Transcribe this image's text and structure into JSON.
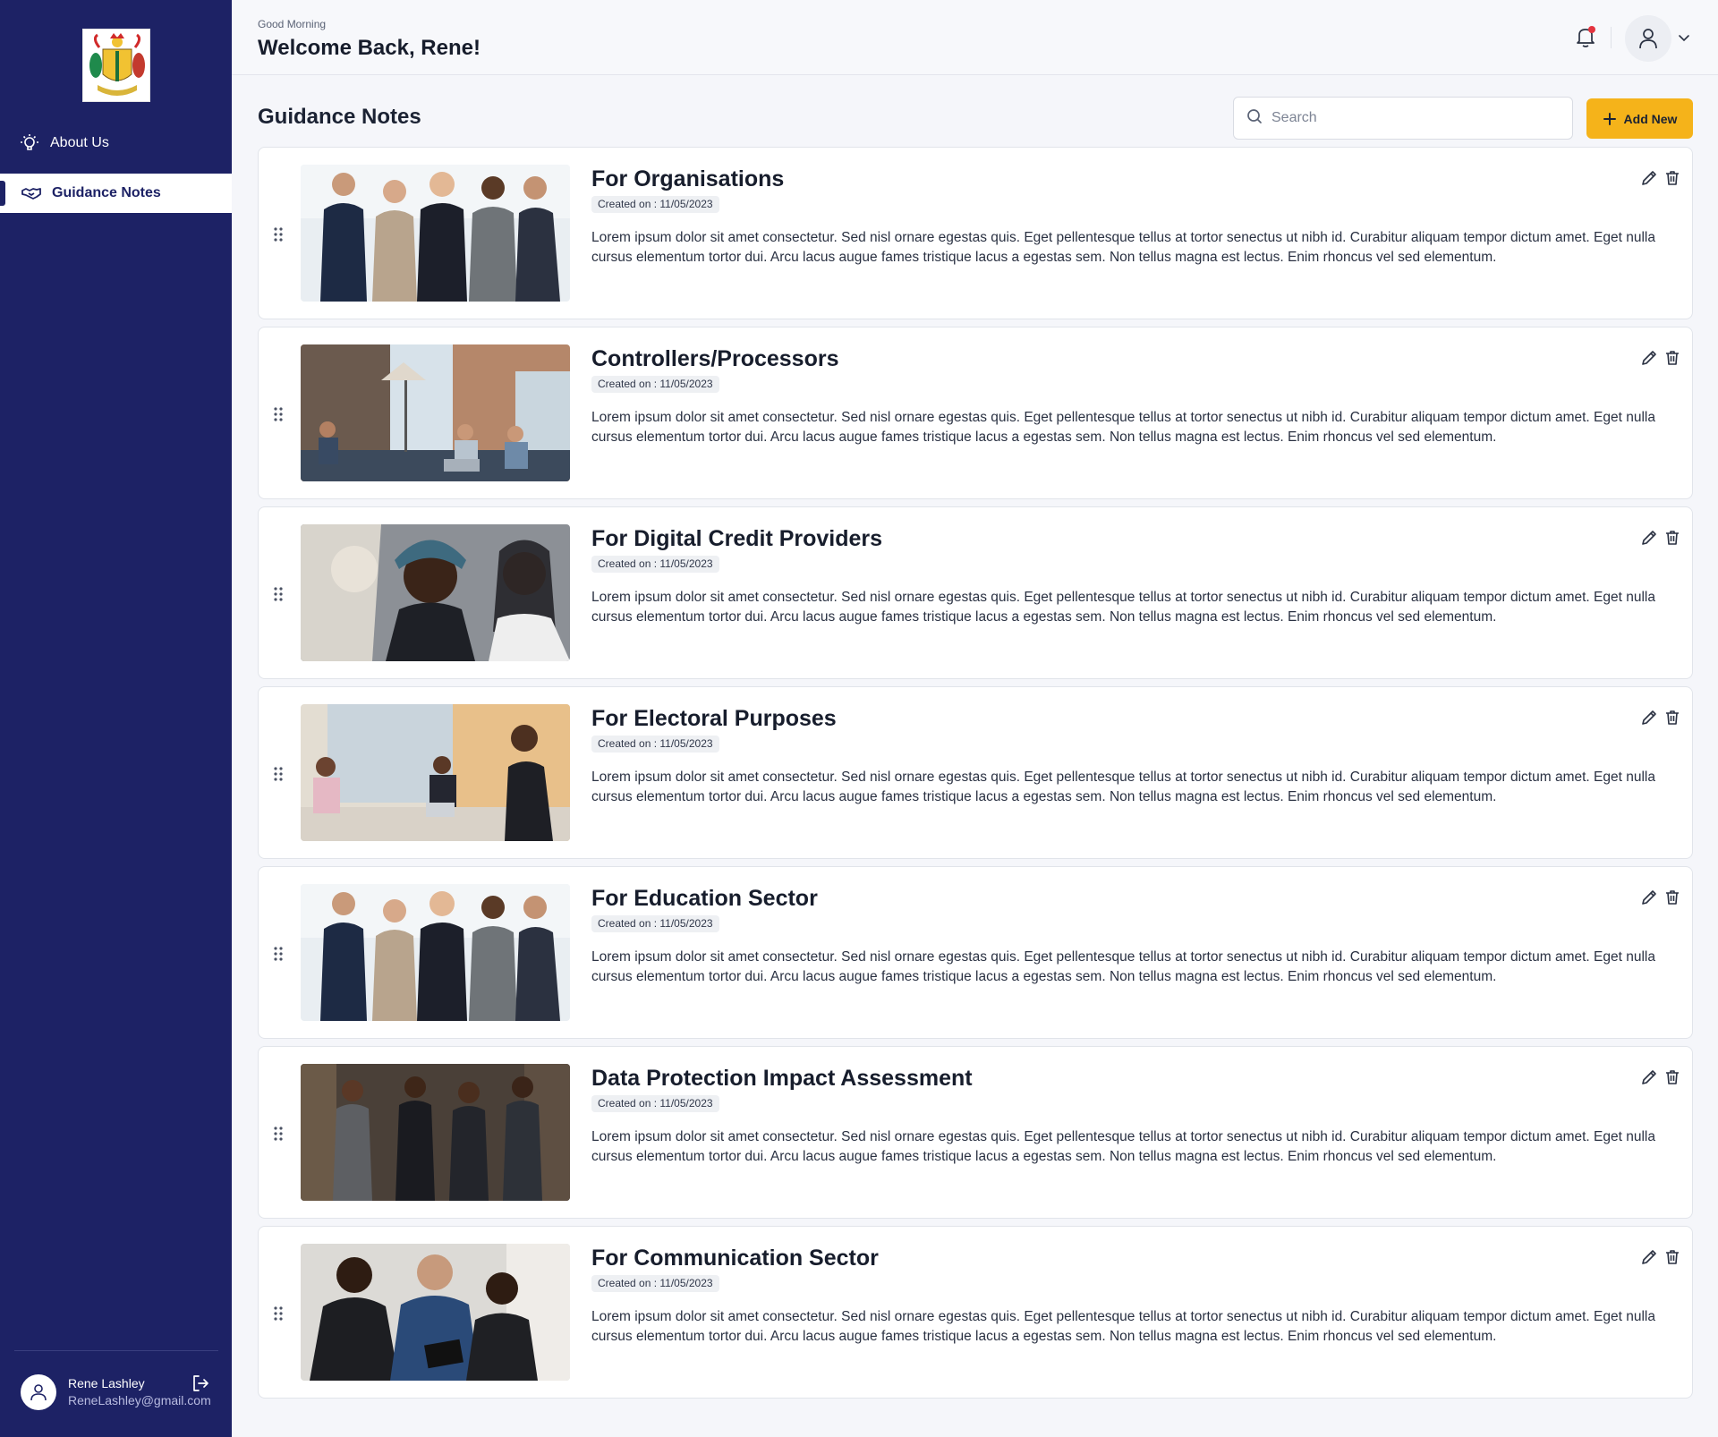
{
  "sidebar": {
    "items": [
      {
        "label": "About Us",
        "icon": "bulb-icon"
      },
      {
        "label": "Guidance Notes",
        "icon": "handshake-icon",
        "active": true
      }
    ],
    "user": {
      "name": "Rene Lashley",
      "email": "ReneLashley@gmail.com"
    }
  },
  "header": {
    "greeting": "Good Morning",
    "welcome": "Welcome Back, Rene!"
  },
  "main": {
    "title": "Guidance Notes",
    "search_placeholder": "Search",
    "add_label": "Add New",
    "cards": [
      {
        "title": "For Organisations",
        "created": "Created on : 11/05/2023",
        "description": "Lorem ipsum dolor sit amet consectetur. Sed nisl ornare egestas quis. Eget pellentesque tellus at tortor senectus ut nibh id. Curabitur aliquam tempor dictum amet. Eget nulla cursus elementum tortor dui. Arcu lacus augue fames tristique lacus a egestas sem. Non tellus magna est lectus. Enim rhoncus vel sed elementum."
      },
      {
        "title": "Controllers/Processors",
        "created": "Created on : 11/05/2023",
        "description": "Lorem ipsum dolor sit amet consectetur. Sed nisl ornare egestas quis. Eget pellentesque tellus at tortor senectus ut nibh id. Curabitur aliquam tempor dictum amet. Eget nulla cursus elementum tortor dui. Arcu lacus augue fames tristique lacus a egestas sem. Non tellus magna est lectus. Enim rhoncus vel sed elementum."
      },
      {
        "title": "For Digital Credit Providers",
        "created": "Created on : 11/05/2023",
        "description": "Lorem ipsum dolor sit amet consectetur. Sed nisl ornare egestas quis. Eget pellentesque tellus at tortor senectus ut nibh id. Curabitur aliquam tempor dictum amet. Eget nulla cursus elementum tortor dui. Arcu lacus augue fames tristique lacus a egestas sem. Non tellus magna est lectus. Enim rhoncus vel sed elementum."
      },
      {
        "title": "For Electoral Purposes",
        "created": "Created on : 11/05/2023",
        "description": "Lorem ipsum dolor sit amet consectetur. Sed nisl ornare egestas quis. Eget pellentesque tellus at tortor senectus ut nibh id. Curabitur aliquam tempor dictum amet. Eget nulla cursus elementum tortor dui. Arcu lacus augue fames tristique lacus a egestas sem. Non tellus magna est lectus. Enim rhoncus vel sed elementum."
      },
      {
        "title": "For Education Sector",
        "created": "Created on : 11/05/2023",
        "description": "Lorem ipsum dolor sit amet consectetur. Sed nisl ornare egestas quis. Eget pellentesque tellus at tortor senectus ut nibh id. Curabitur aliquam tempor dictum amet. Eget nulla cursus elementum tortor dui. Arcu lacus augue fames tristique lacus a egestas sem. Non tellus magna est lectus. Enim rhoncus vel sed elementum."
      },
      {
        "title": "Data Protection Impact Assessment",
        "created": "Created on : 11/05/2023",
        "description": "Lorem ipsum dolor sit amet consectetur. Sed nisl ornare egestas quis. Eget pellentesque tellus at tortor senectus ut nibh id. Curabitur aliquam tempor dictum amet. Eget nulla cursus elementum tortor dui. Arcu lacus augue fames tristique lacus a egestas sem. Non tellus magna est lectus. Enim rhoncus vel sed elementum."
      },
      {
        "title": "For Communication Sector",
        "created": "Created on : 11/05/2023",
        "description": "Lorem ipsum dolor sit amet consectetur. Sed nisl ornare egestas quis. Eget pellentesque tellus at tortor senectus ut nibh id. Curabitur aliquam tempor dictum amet. Eget nulla cursus elementum tortor dui. Arcu lacus augue fames tristique lacus a egestas sem. Non tellus magna est lectus. Enim rhoncus vel sed elementum."
      }
    ]
  },
  "colors": {
    "sidebar": "#1d2265",
    "accent": "#f5b31a",
    "notification": "#e4343f"
  }
}
